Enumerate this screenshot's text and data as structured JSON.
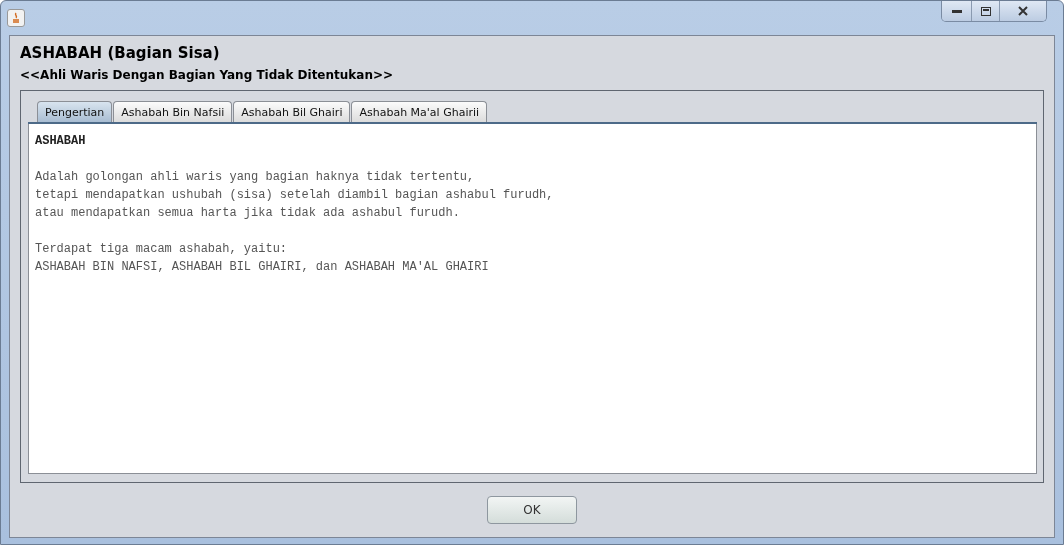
{
  "dialog": {
    "title": "ASHABAH (Bagian Sisa)",
    "subtitle": "<<Ahli Waris Dengan Bagian Yang Tidak Ditentukan>>"
  },
  "tabs": [
    {
      "label": "Pengertian",
      "selected": true
    },
    {
      "label": "Ashabah Bin Nafsii",
      "selected": false
    },
    {
      "label": "Ashabah Bil Ghairi",
      "selected": false
    },
    {
      "label": "Ashabah Ma'al Ghairii",
      "selected": false
    }
  ],
  "content": [
    {
      "kind": "heading",
      "lines": [
        "ASHABAH"
      ]
    },
    {
      "kind": "body",
      "lines": [
        "Adalah golongan ahli waris yang bagian haknya tidak tertentu,",
        "tetapi mendapatkan ushubah (sisa) setelah diambil bagian ashabul furudh,",
        "atau mendapatkan semua harta jika tidak ada ashabul furudh."
      ]
    },
    {
      "kind": "body",
      "lines": [
        "Terdapat tiga macam ashabah, yaitu:",
        "ASHABAH BIN NAFSI, ASHABAH BIL GHAIRI, dan ASHABAH MA'AL GHAIRI"
      ]
    }
  ],
  "buttons": [
    {
      "label": "OK"
    }
  ]
}
